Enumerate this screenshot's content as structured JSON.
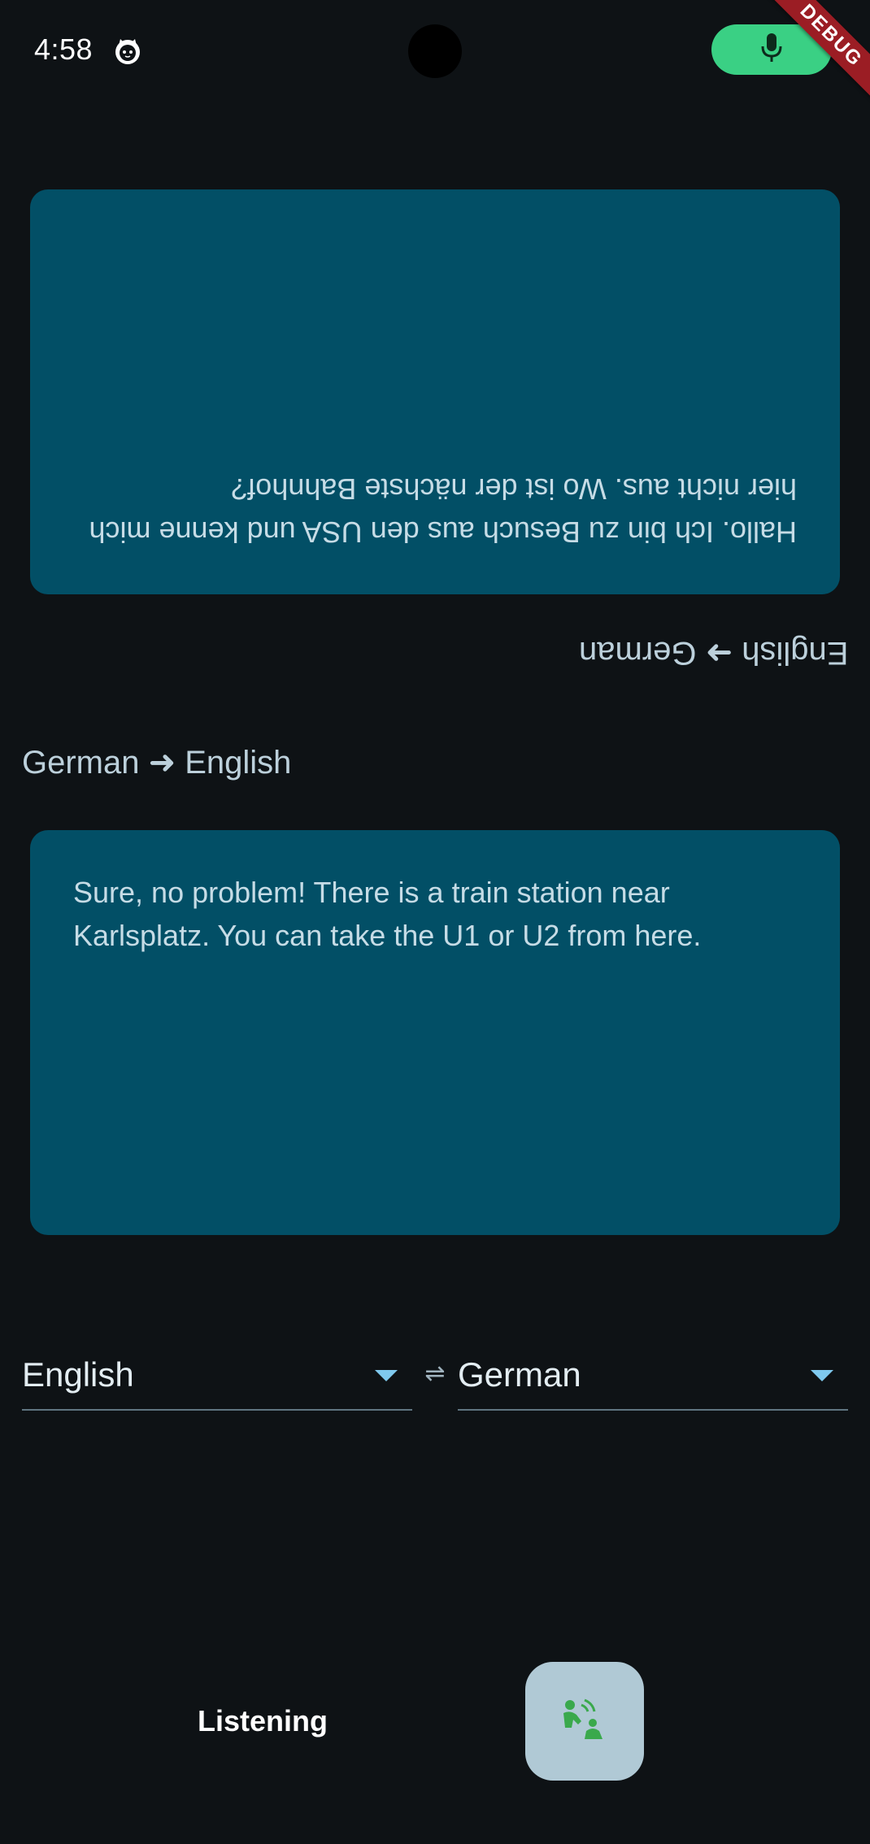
{
  "status_bar": {
    "time": "4:58",
    "app_icon": "cat-face-icon",
    "mic_indicator_icon": "microphone-icon",
    "debug_banner": "DEBUG"
  },
  "top_panel": {
    "direction_label": "English ➜ German",
    "text": "Hallo. Ich bin zu Besuch aus den USA und kenne mich hier nicht aus. Wo ist der nächste Bahnhof?",
    "rotated": "upside-down"
  },
  "bottom_panel": {
    "direction_label": "German ➜ English",
    "text": "Sure, no problem! There is a train station near Karlsplatz. You can take the U1 or U2 from here."
  },
  "language_selectors": {
    "left_value": "English",
    "right_value": "German",
    "swap_symbol": "⇌"
  },
  "footer": {
    "status_text": "Listening",
    "action_icon": "voice-translate-icon"
  },
  "colors": {
    "background": "#0e1215",
    "card": "#024f66",
    "accent": "#3ad084",
    "fab": "#b0c9d5",
    "caret": "#7fc9ee"
  }
}
